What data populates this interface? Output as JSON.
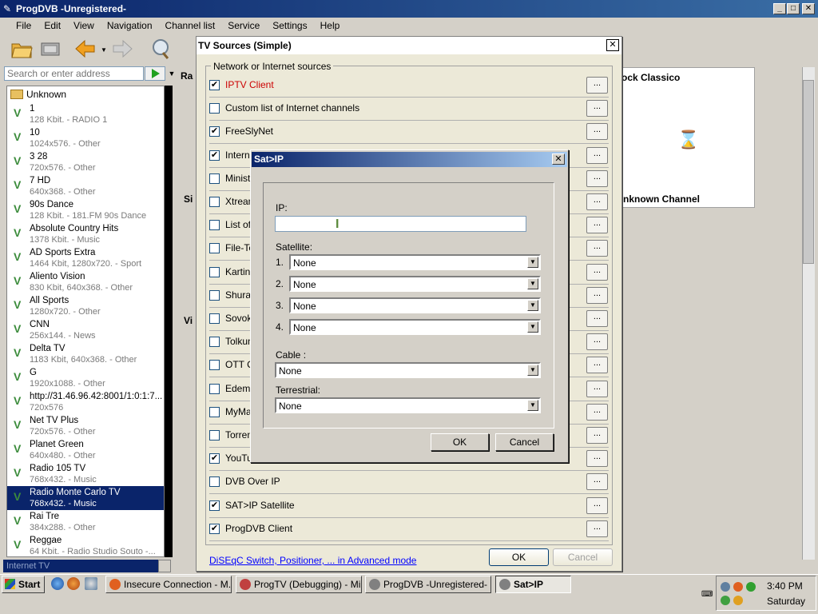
{
  "window": {
    "title": "ProgDVB -Unregistered-"
  },
  "menu": [
    "File",
    "Edit",
    "View",
    "Navigation",
    "Channel list",
    "Service",
    "Settings",
    "Help"
  ],
  "address": {
    "placeholder": "Search or enter address"
  },
  "channel_list": {
    "group": "Unknown",
    "channels": [
      {
        "name": "1",
        "info": "128 Kbit. - RADIO 1"
      },
      {
        "name": "10",
        "info": "1024x576. - Other"
      },
      {
        "name": "3 28",
        "info": "720x576. - Other"
      },
      {
        "name": "7 HD",
        "info": "640x368. - Other"
      },
      {
        "name": "90s Dance",
        "info": "128 Kbit. - 181.FM 90s Dance"
      },
      {
        "name": "Absolute Country Hits",
        "info": "1378 Kbit. - Music"
      },
      {
        "name": "AD Sports Extra",
        "info": "1464 Kbit, 1280x720. - Sport"
      },
      {
        "name": "Aliento Vision",
        "info": "830 Kbit, 640x368. - Other"
      },
      {
        "name": "All Sports",
        "info": "1280x720. - Other"
      },
      {
        "name": "CNN",
        "info": "256x144. - News"
      },
      {
        "name": "Delta TV",
        "info": "1183 Kbit, 640x368. - Other"
      },
      {
        "name": "G",
        "info": "1920x1088. - Other"
      },
      {
        "name": "http://31.46.96.42:8001/1:0:1:7...",
        "info": "720x576"
      },
      {
        "name": "Net TV Plus",
        "info": "720x576. - Other"
      },
      {
        "name": "Planet Green",
        "info": "640x480. - Other"
      },
      {
        "name": "Radio 105 TV",
        "info": "768x432. - Music"
      },
      {
        "name": "Radio Monte Carlo TV",
        "info": "768x432. - Music"
      },
      {
        "name": "Rai Tre",
        "info": "384x288. - Other"
      },
      {
        "name": "Reggae",
        "info": "64 Kbit. - Radio Studio Souto -..."
      }
    ],
    "footer": "Internet TV"
  },
  "background": {
    "stub_r": "Ra",
    "stub_si": "Si",
    "stub_vi": "Vi",
    "panel_header": "ock Classico",
    "panel_footer": "nknown Channel"
  },
  "tv_sources": {
    "title": "TV Sources (Simple)",
    "group_label": "Network or Internet sources",
    "more_label": "...",
    "sources": [
      {
        "label": "IPTV Client",
        "checked": "✔"
      },
      {
        "label": "Custom list of Internet channels",
        "checked": ""
      },
      {
        "label": "FreeSlyNet",
        "checked": "✔"
      },
      {
        "label": "Interne",
        "checked": "✔"
      },
      {
        "label": "Ministr",
        "checked": ""
      },
      {
        "label": "Xtream",
        "checked": ""
      },
      {
        "label": "List of",
        "checked": ""
      },
      {
        "label": "File-Te",
        "checked": ""
      },
      {
        "label": "Kartina",
        "checked": ""
      },
      {
        "label": "Shura",
        "checked": ""
      },
      {
        "label": "Sovok",
        "checked": ""
      },
      {
        "label": "Tolkun",
        "checked": ""
      },
      {
        "label": "OTT C",
        "checked": ""
      },
      {
        "label": "Edem",
        "checked": ""
      },
      {
        "label": "MyMag",
        "checked": ""
      },
      {
        "label": "Torren",
        "checked": ""
      },
      {
        "label": "YouTube",
        "checked": "✔"
      },
      {
        "label": "DVB Over IP",
        "checked": ""
      },
      {
        "label": "SAT>IP Satellite",
        "checked": "✔"
      },
      {
        "label": "ProgDVB Client",
        "checked": "✔"
      }
    ],
    "advanced_link": "DiSEqC Switch, Positioner, ... in Advanced mode",
    "ok": "OK",
    "cancel": "Cancel"
  },
  "satip": {
    "title": "Sat>IP",
    "ip_label": "IP:",
    "ip_value": "",
    "satellite_label": "Satellite:",
    "satellites": [
      {
        "num": "1.",
        "value": "None"
      },
      {
        "num": "2.",
        "value": "None"
      },
      {
        "num": "3.",
        "value": "None"
      },
      {
        "num": "4.",
        "value": "None"
      }
    ],
    "cable_label": "Cable :",
    "cable_value": "None",
    "terrestrial_label": "Terrestrial:",
    "terrestrial_value": "None",
    "ok": "OK",
    "cancel": "Cancel"
  },
  "taskbar": {
    "start": "Start",
    "tasks": [
      {
        "label": "Insecure Connection - M..."
      },
      {
        "label": "ProgTV (Debugging) - Mi..."
      },
      {
        "label": "ProgDVB -Unregistered-"
      },
      {
        "label": "Sat>IP"
      }
    ],
    "time": "3:40 PM",
    "day": "Saturday"
  },
  "colors": {
    "selection": "#0a246a",
    "iptv_label": "#cc0000",
    "link": "#0000ff"
  }
}
